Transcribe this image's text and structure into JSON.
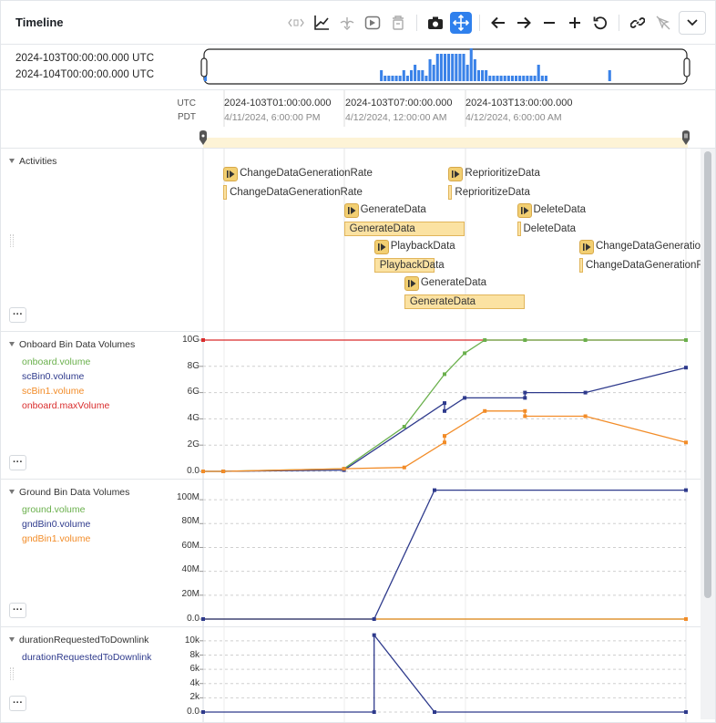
{
  "header": {
    "title": "Timeline",
    "tools": [
      "code-brackets-icon",
      "line-chart-icon",
      "filter-down-icon",
      "play-box-icon",
      "trash-icon",
      "camera-icon",
      "move-arrows-icon",
      "arrow-left-icon",
      "arrow-right-icon",
      "minus-icon",
      "plus-icon",
      "reset-icon",
      "link-icon",
      "cursor-off-icon",
      "chevron-down-icon"
    ]
  },
  "range": {
    "start": "2024-103T00:00:00.000 UTC",
    "end": "2024-104T00:00:00.000 UTC",
    "histogram": [
      2,
      0,
      0,
      0,
      0,
      0,
      0,
      0,
      0,
      0,
      0,
      0,
      0,
      0,
      0,
      0,
      0,
      0,
      0,
      0,
      0,
      0,
      0,
      0,
      0,
      0,
      0,
      0,
      0,
      0,
      0,
      0,
      0,
      0,
      0,
      0,
      0,
      0,
      0,
      0,
      0,
      0,
      0,
      0,
      0,
      0,
      0,
      2,
      1,
      1,
      1,
      1,
      1,
      2,
      1,
      2,
      3,
      2,
      2,
      1,
      4,
      3,
      5,
      5,
      5,
      5,
      5,
      5,
      5,
      5,
      3,
      6,
      4,
      2,
      2,
      2,
      1,
      1,
      1,
      1,
      1,
      1,
      1,
      1,
      1,
      1,
      1,
      1,
      1,
      3,
      1,
      1,
      0,
      0,
      0,
      0,
      0,
      0,
      0,
      0,
      0,
      0,
      0,
      0,
      0,
      0,
      0,
      0,
      2,
      0,
      0,
      0,
      0,
      0,
      0,
      0,
      0,
      0,
      0,
      0,
      0,
      0,
      0,
      0,
      0,
      0,
      0,
      0,
      0
    ]
  },
  "axis": {
    "tz_primary": "UTC",
    "tz_secondary": "PDT",
    "ticks": [
      {
        "utc": "2024-103T01:00:00.000",
        "local": "4/11/2024, 6:00:00 PM"
      },
      {
        "utc": "2024-103T07:00:00.000",
        "local": "4/12/2024, 12:00:00 AM"
      },
      {
        "utc": "2024-103T13:00:00.000",
        "local": "4/12/2024, 6:00:00 AM"
      }
    ]
  },
  "more_label": "···",
  "rows": {
    "activities": {
      "title": "Activities",
      "items": [
        {
          "name": "ChangeDataGenerationRate",
          "start": 1.0,
          "end": 1.15
        },
        {
          "name": "ReprioritizeData",
          "start": 12.2,
          "end": 12.35
        },
        {
          "name": "GenerateData",
          "start": 7.0,
          "end": 13.0
        },
        {
          "name": "DeleteData",
          "start": 15.6,
          "end": 15.75
        },
        {
          "name": "PlaybackData",
          "start": 8.5,
          "end": 11.5
        },
        {
          "name": "ChangeDataGenerationRate",
          "start": 18.7,
          "end": 18.85
        },
        {
          "name": "GenerateData",
          "start": 10.0,
          "end": 16.0
        }
      ]
    },
    "onboard": {
      "title": "Onboard Bin Data Volumes",
      "legend": [
        {
          "name": "onboard.volume",
          "color": "#6ab04c"
        },
        {
          "name": "scBin0.volume",
          "color": "#2e3a8c"
        },
        {
          "name": "scBin1.volume",
          "color": "#f28c28"
        },
        {
          "name": "onboard.maxVolume",
          "color": "#d92c2c"
        }
      ],
      "yticks": [
        "10G",
        "8G",
        "6G",
        "4G",
        "2G",
        "0.0"
      ]
    },
    "ground": {
      "title": "Ground Bin Data Volumes",
      "legend": [
        {
          "name": "ground.volume",
          "color": "#6ab04c"
        },
        {
          "name": "gndBin0.volume",
          "color": "#2e3a8c"
        },
        {
          "name": "gndBin1.volume",
          "color": "#f28c28"
        }
      ],
      "yticks": [
        "100M",
        "80M",
        "60M",
        "40M",
        "20M",
        "0.0"
      ]
    },
    "duration": {
      "title": "durationRequestedToDownlink",
      "legend": [
        {
          "name": "durationRequestedToDownlink",
          "color": "#2e3a8c"
        }
      ],
      "yticks": [
        "10k",
        "8k",
        "6k",
        "4k",
        "2k",
        "0.0"
      ]
    }
  },
  "chart_data": [
    {
      "type": "line",
      "title": "Onboard Bin Data Volumes",
      "x_unit": "hours since 2024-103T00:00:00",
      "ylim": [
        0,
        10000000000
      ],
      "series": [
        {
          "name": "onboard.maxVolume",
          "color": "#d92c2c",
          "points": [
            [
              0,
              10000000000
            ],
            [
              24,
              10000000000
            ]
          ]
        },
        {
          "name": "onboard.volume",
          "color": "#6ab04c",
          "points": [
            [
              0,
              0
            ],
            [
              1,
              0
            ],
            [
              7,
              200000000
            ],
            [
              10,
              3400000000
            ],
            [
              12,
              7400000000
            ],
            [
              13,
              9000000000
            ],
            [
              14,
              10000000000
            ],
            [
              16,
              10000000000
            ],
            [
              19,
              10000000000
            ],
            [
              24,
              10000000000
            ]
          ]
        },
        {
          "name": "scBin0.volume",
          "color": "#2e3a8c",
          "points": [
            [
              0,
              0
            ],
            [
              1,
              0
            ],
            [
              7,
              100000000
            ],
            [
              12,
              5200000000
            ],
            [
              12,
              4600000000
            ],
            [
              13,
              5600000000
            ],
            [
              16,
              5600000000
            ],
            [
              16,
              6000000000
            ],
            [
              19,
              6000000000
            ],
            [
              24,
              7900000000
            ]
          ]
        },
        {
          "name": "scBin1.volume",
          "color": "#f28c28",
          "points": [
            [
              0,
              0
            ],
            [
              1,
              0
            ],
            [
              7,
              200000000
            ],
            [
              10,
              300000000
            ],
            [
              12,
              2200000000
            ],
            [
              12,
              2700000000
            ],
            [
              14,
              4600000000
            ],
            [
              16,
              4600000000
            ],
            [
              16,
              4200000000
            ],
            [
              19,
              4200000000
            ],
            [
              24,
              2200000000
            ]
          ]
        }
      ]
    },
    {
      "type": "line",
      "title": "Ground Bin Data Volumes",
      "x_unit": "hours since 2024-103T00:00:00",
      "ylim": [
        0,
        110000000
      ],
      "series": [
        {
          "name": "ground.volume",
          "color": "#6ab04c",
          "points": [
            [
              0,
              0
            ],
            [
              24,
              0
            ]
          ]
        },
        {
          "name": "gndBin1.volume",
          "color": "#f28c28",
          "points": [
            [
              0,
              0
            ],
            [
              24,
              0
            ]
          ]
        },
        {
          "name": "gndBin0.volume",
          "color": "#2e3a8c",
          "points": [
            [
              0,
              0
            ],
            [
              8.5,
              0
            ],
            [
              11.5,
              108000000
            ],
            [
              24,
              108000000
            ]
          ]
        }
      ]
    },
    {
      "type": "line",
      "title": "durationRequestedToDownlink",
      "x_unit": "hours since 2024-103T00:00:00",
      "ylim": [
        0,
        11000
      ],
      "series": [
        {
          "name": "durationRequestedToDownlink",
          "color": "#2e3a8c",
          "points": [
            [
              0,
              0
            ],
            [
              8.5,
              0
            ],
            [
              8.5,
              10800
            ],
            [
              11.5,
              0
            ],
            [
              24,
              0
            ]
          ]
        }
      ]
    }
  ]
}
